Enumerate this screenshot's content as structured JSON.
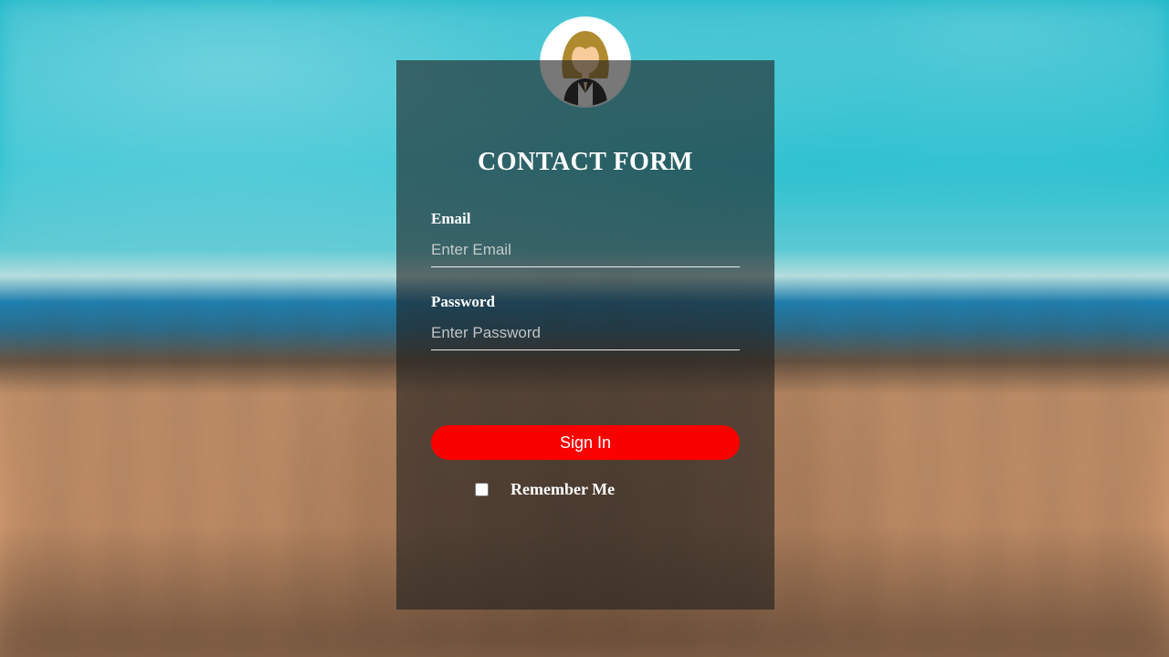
{
  "form": {
    "title": "CONTACT FORM",
    "email": {
      "label": "Email",
      "placeholder": "Enter Email",
      "value": ""
    },
    "password": {
      "label": "Password",
      "placeholder": "Enter Password",
      "value": ""
    },
    "submit_label": "Sign In",
    "remember_label": "Remember Me",
    "remember_checked": false
  },
  "colors": {
    "accent": "#f90101",
    "card_bg": "rgba(30,30,30,0.60)"
  }
}
